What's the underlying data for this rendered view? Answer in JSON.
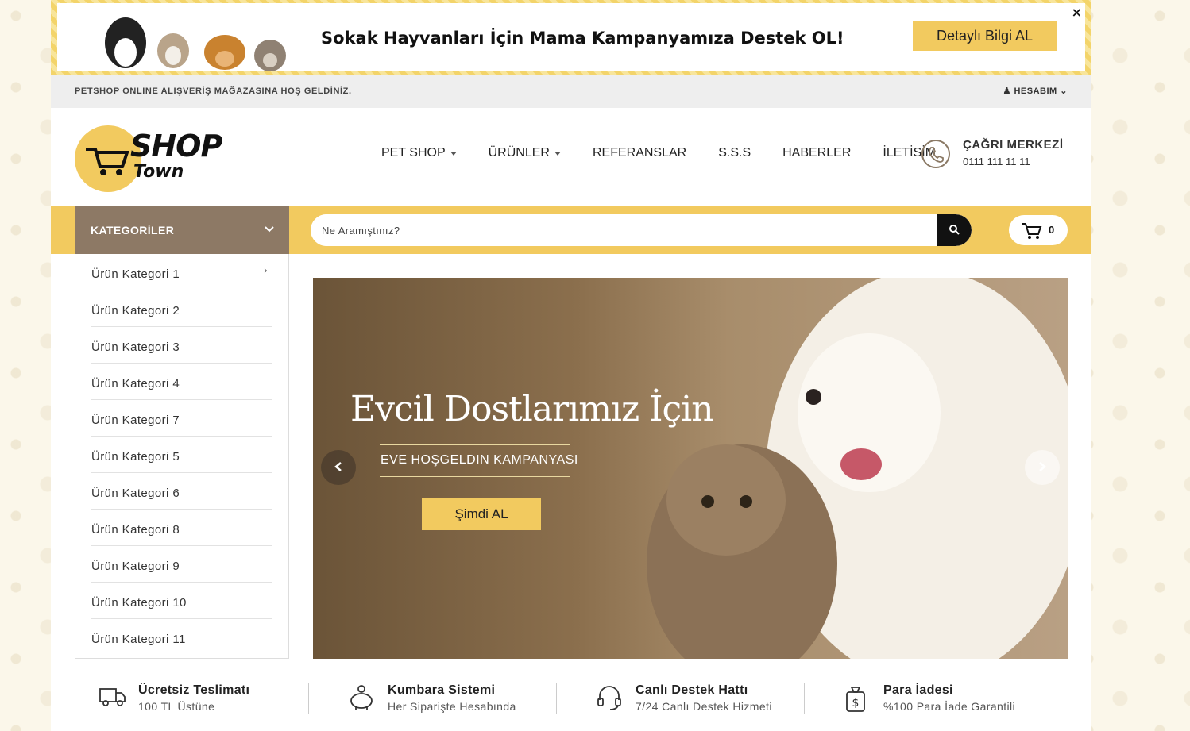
{
  "promo": {
    "text": "Sokak Hayvanları İçin Mama Kampanyamıza Destek OL!",
    "button_label": "Detaylı Bilgi AL",
    "close_label": "×"
  },
  "topbar": {
    "welcome": "PETSHOP ONLINE ALIŞVERİŞ MAĞAZASINA HOŞ GELDİNİZ.",
    "account_label": "HESABIM"
  },
  "logo": {
    "line1": "SHOP",
    "line2": "Town"
  },
  "nav": {
    "items": [
      {
        "label": "PET SHOP",
        "has_dropdown": true
      },
      {
        "label": "ÜRÜNLER",
        "has_dropdown": true
      },
      {
        "label": "REFERANSLAR",
        "has_dropdown": false
      },
      {
        "label": "S.S.S",
        "has_dropdown": false
      },
      {
        "label": "HABERLER",
        "has_dropdown": false
      },
      {
        "label": "İLETİSİM",
        "has_dropdown": false
      }
    ]
  },
  "callcenter": {
    "title": "ÇAĞRI MERKEZİ",
    "phone": "0111 111 11 11"
  },
  "categories": {
    "header": "KATEGORİLER",
    "items": [
      "Ürün Kategori 1",
      "Ürün Kategori 2",
      "Ürün Kategori 3",
      "Ürün Kategori 4",
      "Ürün Kategori 7",
      "Ürün Kategori 5",
      "Ürün Kategori 6",
      "Ürün Kategori 8",
      "Ürün Kategori 9",
      "Ürün Kategori 10",
      "Ürün Kategori 11"
    ]
  },
  "search": {
    "placeholder": "Ne Aramıştınız?"
  },
  "cart": {
    "count": "0"
  },
  "slider": {
    "title": "Evcil Dostlarımız İçin",
    "subtitle": "EVE HOŞGELDIN KAMPANYASI",
    "button_label": "Şimdi AL"
  },
  "features": [
    {
      "title": "Ücretsiz Teslimatı",
      "subtitle": "100 TL Üstüne",
      "icon": "truck-icon"
    },
    {
      "title": "Kumbara Sistemi",
      "subtitle": "Her Siparişte Hesabında",
      "icon": "piggy-bank-icon"
    },
    {
      "title": "Canlı Destek Hattı",
      "subtitle": "7/24 Canlı Destek Hizmeti",
      "icon": "headset-icon"
    },
    {
      "title": "Para İadesi",
      "subtitle": "%100 Para İade Garantili",
      "icon": "money-bag-icon"
    }
  ],
  "colors": {
    "accent": "#f2ca5f",
    "category_header": "#8d7965",
    "topbar": "#eeeeee"
  }
}
